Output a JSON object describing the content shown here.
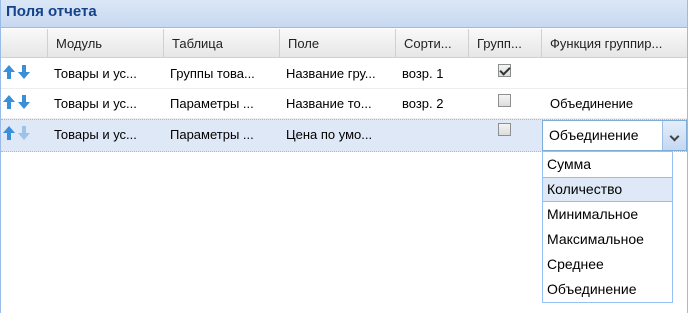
{
  "panel": {
    "title": "Поля отчета"
  },
  "columns": [
    "",
    "Модуль",
    "Таблица",
    "Поле",
    "Сорти...",
    "Групп...",
    "Функция группир..."
  ],
  "rows": [
    {
      "module": "Товары и ус...",
      "table": "Группы това...",
      "field": "Название гру...",
      "sort": "возр. 1",
      "grouped": true,
      "function": ""
    },
    {
      "module": "Товары и ус...",
      "table": "Параметры ...",
      "field": "Название то...",
      "sort": "возр. 2",
      "grouped": false,
      "function": "Объединение"
    },
    {
      "module": "Товары и ус...",
      "table": "Параметры ...",
      "field": "Цена по умо...",
      "sort": "",
      "grouped": false,
      "function": "Объединение"
    }
  ],
  "combo": {
    "value": "Объединение"
  },
  "dropdown": {
    "options": [
      "Сумма",
      "Количество",
      "Минимальное",
      "Максимальное",
      "Среднее",
      "Объединение"
    ],
    "highlighted_index": 1
  },
  "colors": {
    "title": "#15428b",
    "arrow": "#3a8fd9",
    "selection": "#dfe8f6"
  },
  "icons": {
    "move_up": "arrow-up-icon",
    "move_down": "arrow-down-icon"
  }
}
